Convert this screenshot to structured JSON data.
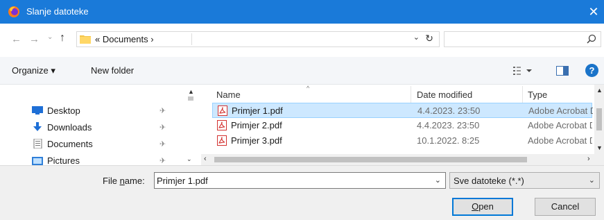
{
  "window": {
    "title": "Slanje datoteke",
    "close_glyph": "✕",
    "app_icon": "firefox-icon",
    "titlebar_color": "#1a7ad9"
  },
  "address_bar": {
    "back_glyph": "←",
    "forward_glyph": "→",
    "recent_glyph": "⌄",
    "up_glyph": "↑",
    "breadcrumb": "« Documents  ›",
    "dropdown_glyph": "⌄",
    "refresh_glyph": "↻",
    "search_placeholder": ""
  },
  "toolbar": {
    "organize_label": "Organize ▾",
    "new_folder_label": "New folder",
    "help_label": "?"
  },
  "nav_pane": {
    "items": [
      {
        "label": "Desktop",
        "icon": "desktop-icon"
      },
      {
        "label": "Downloads",
        "icon": "downloads-icon"
      },
      {
        "label": "Documents",
        "icon": "documents-icon"
      },
      {
        "label": "Pictures",
        "icon": "pictures-icon"
      }
    ],
    "pin_glyph": "📌"
  },
  "file_list": {
    "columns": {
      "name": "Name",
      "date_modified": "Date modified",
      "type": "Type"
    },
    "sort_glyph": "^",
    "rows": [
      {
        "name": "Primjer 1.pdf",
        "date": "4.4.2023. 23:50",
        "type": "Adobe Acrobat D",
        "selected": true
      },
      {
        "name": "Primjer 2.pdf",
        "date": "4.4.2023. 23:50",
        "type": "Adobe Acrobat D",
        "selected": false
      },
      {
        "name": "Primjer 3.pdf",
        "date": "10.1.2022. 8:25",
        "type": "Adobe Acrobat D",
        "selected": false
      }
    ]
  },
  "bottom": {
    "file_name_label_prefix": "File ",
    "file_name_label_accel": "n",
    "file_name_label_suffix": "ame:",
    "file_name_value": "Primjer 1.pdf",
    "file_type_value": "Sve datoteke (*.*)",
    "open_label_accel": "O",
    "open_label_rest": "pen",
    "cancel_label": "Cancel",
    "dropdown_glyph": "⌄"
  }
}
